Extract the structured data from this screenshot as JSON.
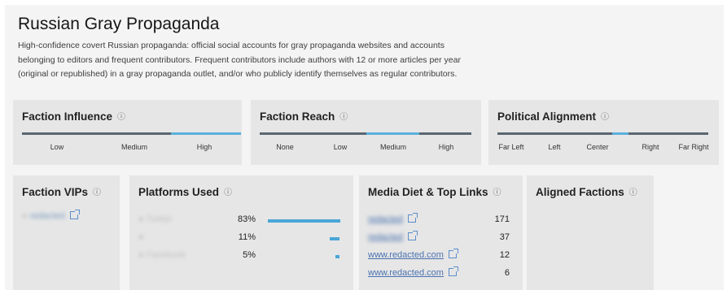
{
  "header": {
    "title": "Russian Gray Propaganda",
    "description": "High-confidence covert Russian propaganda: official social accounts for gray propaganda websites and accounts belonging to editors and frequent contributors. Frequent contributors include authors with 12 or more articles per year (original or republished) in a gray propaganda outlet, and/or who publicly identify themselves as regular contributors."
  },
  "influence": {
    "title": "Faction Influence",
    "labels": [
      "Low",
      "Medium",
      "High"
    ],
    "selected": "High"
  },
  "reach": {
    "title": "Faction Reach",
    "labels": [
      "None",
      "Low",
      "Medium",
      "High"
    ],
    "selected": "Medium"
  },
  "alignment": {
    "title": "Political Alignment",
    "labels": [
      "Far Left",
      "Left",
      "Center",
      "Right",
      "Far Right"
    ],
    "selected": "Center"
  },
  "vips": {
    "title": "Faction VIPs",
    "items": [
      {
        "name": "redacted"
      }
    ]
  },
  "platforms": {
    "title": "Platforms Used",
    "items": [
      {
        "name": "Twitter",
        "percent": "83%",
        "value": 83
      },
      {
        "name": "",
        "percent": "11%",
        "value": 11
      },
      {
        "name": "Facebook",
        "percent": "5%",
        "value": 5
      }
    ]
  },
  "media": {
    "title": "Media Diet & Top Links",
    "links": [
      {
        "text": "redacted",
        "count": "171"
      },
      {
        "text": "redacted",
        "count": "37"
      },
      {
        "text": "www.redacted.com",
        "count": "12"
      },
      {
        "text": "www.redacted.com",
        "count": "6"
      }
    ]
  },
  "aligned": {
    "title": "Aligned Factions"
  },
  "colors": {
    "accent": "#5ab0dc",
    "scale_dark": "#5a6670",
    "bar": "#4aa6d8",
    "link": "#4a72b0"
  },
  "icons": {
    "info": "info-circle-icon",
    "external": "external-link-icon",
    "avatar": "avatar-icon"
  }
}
